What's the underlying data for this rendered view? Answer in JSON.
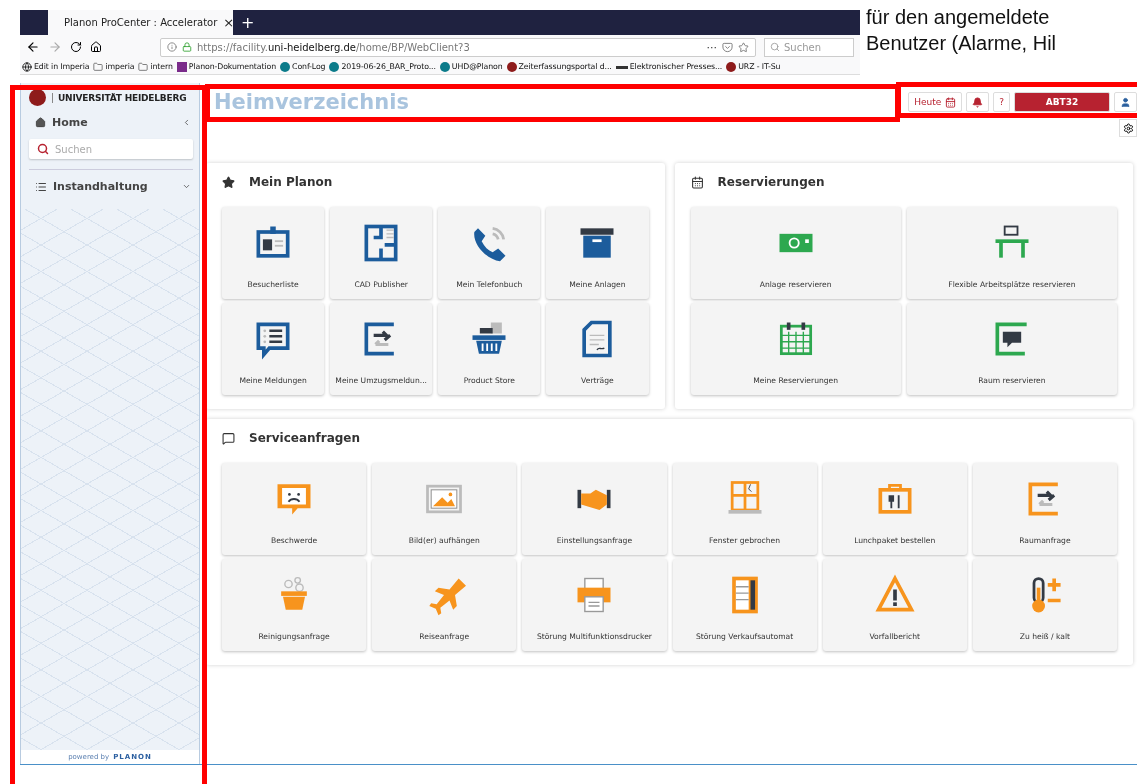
{
  "browser": {
    "tab": {
      "title": "Planon ProCenter : Accelerator",
      "close": "×",
      "selected": true
    },
    "new_tab": "+",
    "url": {
      "prefix": "https://facility.",
      "domain": "uni-heidelberg.de",
      "path": "/home/BP/WebClient?3"
    },
    "more": "···",
    "search": {
      "placeholder": "Suchen"
    },
    "bookmarks": [
      {
        "label": "Edit in Imperia",
        "kind": "globe"
      },
      {
        "label": "imperia",
        "kind": "folder"
      },
      {
        "label": "intern",
        "kind": "folder"
      },
      {
        "label": "Planon-Dokumentation",
        "kind": "onenote"
      },
      {
        "label": "Conf-Log",
        "kind": "sharepoint"
      },
      {
        "label": "2019-06-26_BAR_Proto...",
        "kind": "sharepoint"
      },
      {
        "label": "UHD@Planon",
        "kind": "sharepoint"
      },
      {
        "label": "Zeiterfassungsportal d...",
        "kind": "seal"
      },
      {
        "label": "Elektronischer Presses...",
        "kind": "pkp"
      },
      {
        "label": "URZ - IT-Su",
        "kind": "seal"
      }
    ]
  },
  "annotation": {
    "lines": [
      "für den angemeldete",
      "Benutzer (Alarme, Hil"
    ]
  },
  "sidebar": {
    "logo": "UNIVERSITÄT HEIDELBERG",
    "home": {
      "label": "Home",
      "expanded": true
    },
    "search": {
      "placeholder": "Suchen"
    },
    "items": [
      {
        "label": "Instandhaltung",
        "expanded": false
      }
    ],
    "footer": {
      "prefix": "powered by",
      "brand": "PLANON"
    }
  },
  "header": {
    "title": "Heimverzeichnis",
    "today": "Heute",
    "help": "?",
    "user": "ABT32"
  },
  "sections": [
    {
      "title": "Mein Planon",
      "kind": "star",
      "color": "#1c5c9c",
      "tiles": [
        "Besucherliste",
        "CAD Publisher",
        "Mein Telefonbuch",
        "Meine Anlagen",
        "Meine Meldungen",
        "Meine Umzugsmeldun...",
        "Product Store",
        "Verträge"
      ]
    },
    {
      "title": "Reservierungen",
      "kind": "calendar",
      "color": "#2da84f",
      "tiles": [
        "Anlage reservieren",
        "Flexible Arbeitsplätze reservieren",
        "Meine Reservierungen",
        "Raum reservieren"
      ]
    },
    {
      "title": "Serviceanfragen",
      "kind": "comment",
      "color": "#f7941d",
      "tiles": [
        "Beschwerde",
        "Bild(er) aufhängen",
        "Einstellungsanfrage",
        "Fenster gebrochen",
        "Lunchpaket bestellen",
        "Raumanfrage",
        "Reinigungsanfrage",
        "Reiseanfrage",
        "Störung Multifunktionsdrucker",
        "Störung Verkaufsautomat",
        "Vorfallbericht",
        "Zu heiß / kalt"
      ]
    }
  ]
}
